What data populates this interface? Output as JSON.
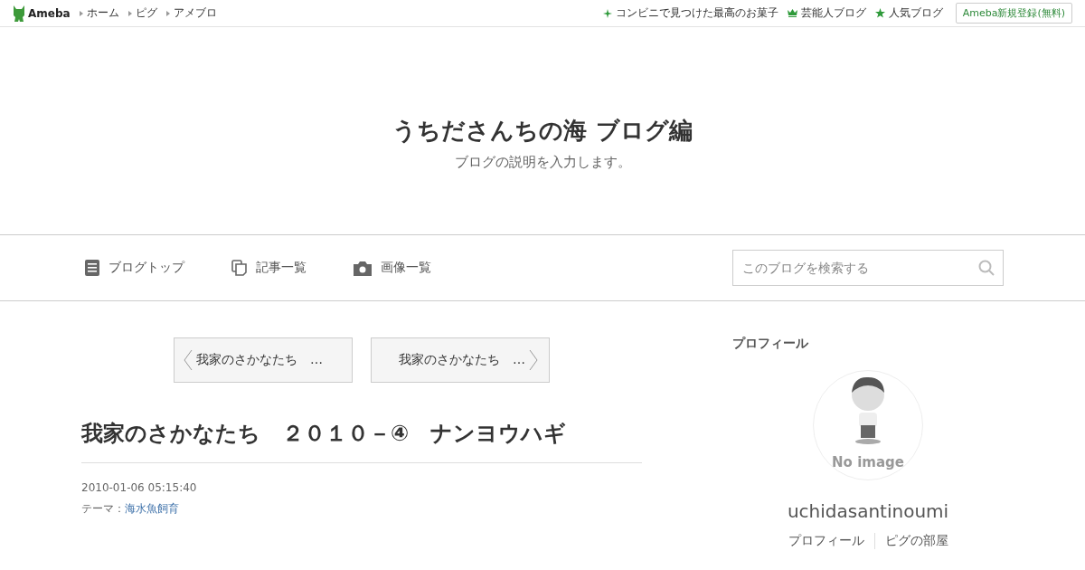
{
  "topbar": {
    "logo": "Ameba",
    "links": [
      {
        "label": "ホーム"
      },
      {
        "label": "ピグ"
      },
      {
        "label": "アメブロ"
      }
    ],
    "right_links": [
      {
        "label": "コンビニで見つけた最高のお菓子",
        "kind": "sparkle"
      },
      {
        "label": "芸能人ブログ",
        "kind": "crown"
      },
      {
        "label": "人気ブログ",
        "kind": "star"
      }
    ],
    "signup": "Ameba新規登録(無料)"
  },
  "blog": {
    "title": "うちださんちの海 ブログ編",
    "description": "ブログの説明を入力します。"
  },
  "nav": {
    "items": [
      {
        "label": "ブログトップ",
        "kind": "doc"
      },
      {
        "label": "記事一覧",
        "kind": "copy"
      },
      {
        "label": "画像一覧",
        "kind": "camera"
      }
    ],
    "search": {
      "placeholder": "このブログを検索する"
    }
  },
  "pager": [
    {
      "label": "我家のさかなたち　…",
      "kind": "prev"
    },
    {
      "label": "我家のさかなたち　…",
      "kind": "next"
    }
  ],
  "article": {
    "title": "我家のさかなたち　２０１０－④　ナンヨウハギ",
    "date": "2010-01-06 05:15:40",
    "theme_label": "テーマ：",
    "theme": "海水魚飼育"
  },
  "profile": {
    "heading": "プロフィール",
    "avatar_text": "No image",
    "name": "uchidasantinoumi",
    "links": [
      {
        "label": "プロフィール"
      },
      {
        "label": "ピグの部屋"
      }
    ]
  }
}
